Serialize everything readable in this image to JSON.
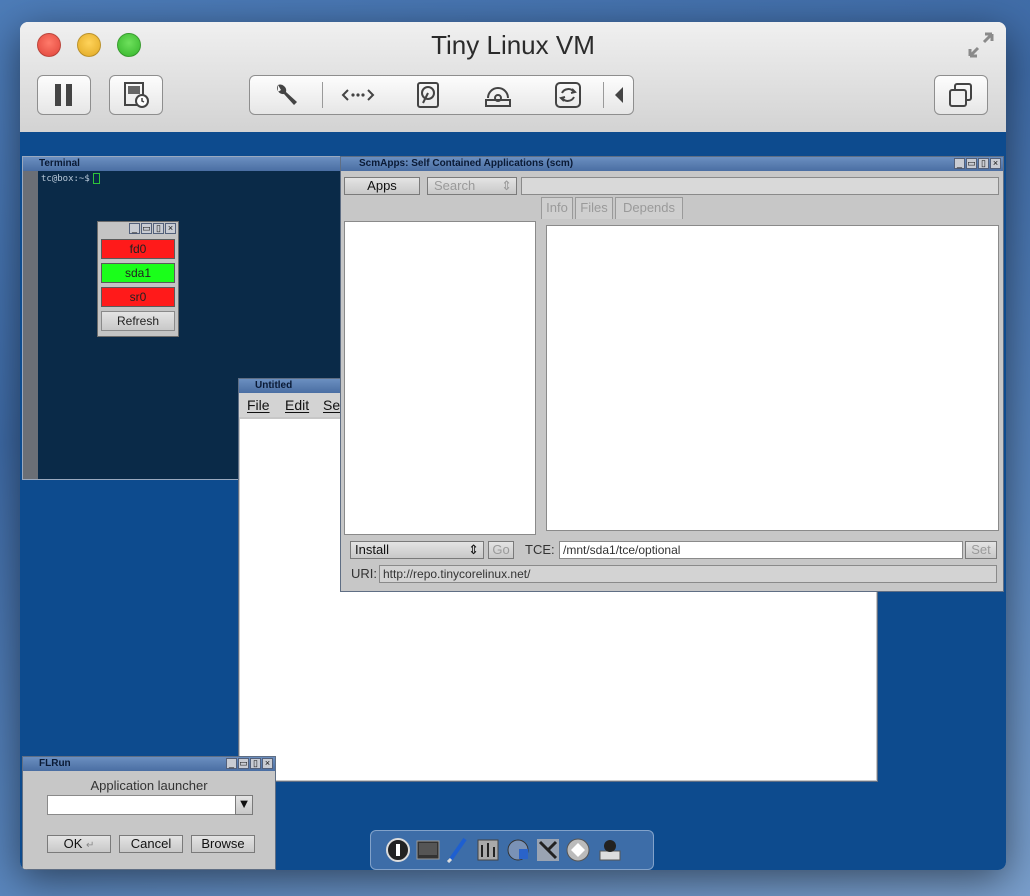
{
  "window": {
    "title": "Tiny Linux VM"
  },
  "toolbar": {
    "left_buttons": [
      "pause-icon",
      "snapshot-icon"
    ],
    "segmented": [
      "wrench-icon",
      "network-icon",
      "harddisk-icon",
      "optical-disc-icon",
      "usb-sync-icon",
      "chevron-left-icon"
    ],
    "right_button": "windows-icon"
  },
  "terminal": {
    "title": "Terminal",
    "prompt": "tc@box:~$"
  },
  "mount_tool": {
    "buttons": [
      "fd0",
      "sda1",
      "sr0"
    ],
    "refresh_label": "Refresh"
  },
  "colors": {
    "unmounted": "#ff1a1a",
    "mounted": "#1aff1a",
    "desktop": "#0d4b8e"
  },
  "editor": {
    "title": "Untitled",
    "menu": [
      "File",
      "Edit",
      "Se"
    ]
  },
  "scm": {
    "title": "ScmApps: Self Contained Applications (scm)",
    "apps_label": "Apps",
    "search_label": "Search",
    "tabs": [
      "Info",
      "Files",
      "Depends"
    ],
    "install_label": "Install",
    "go_label": "Go",
    "tce_label": "TCE:",
    "tce_value": "/mnt/sda1/tce/optional",
    "set_label": "Set",
    "uri_label": "URI:",
    "uri_value": "http://repo.tinycorelinux.net/"
  },
  "flrun": {
    "title": "FLRun",
    "heading": "Application launcher",
    "ok_label": "OK",
    "cancel_label": "Cancel",
    "browse_label": "Browse"
  },
  "dock": {
    "icons": [
      "info-icon",
      "terminal-icon",
      "editor-brush-icon",
      "control-panel-icon",
      "apps-icon",
      "tools-icon",
      "mount-icon",
      "exit-icon"
    ]
  }
}
